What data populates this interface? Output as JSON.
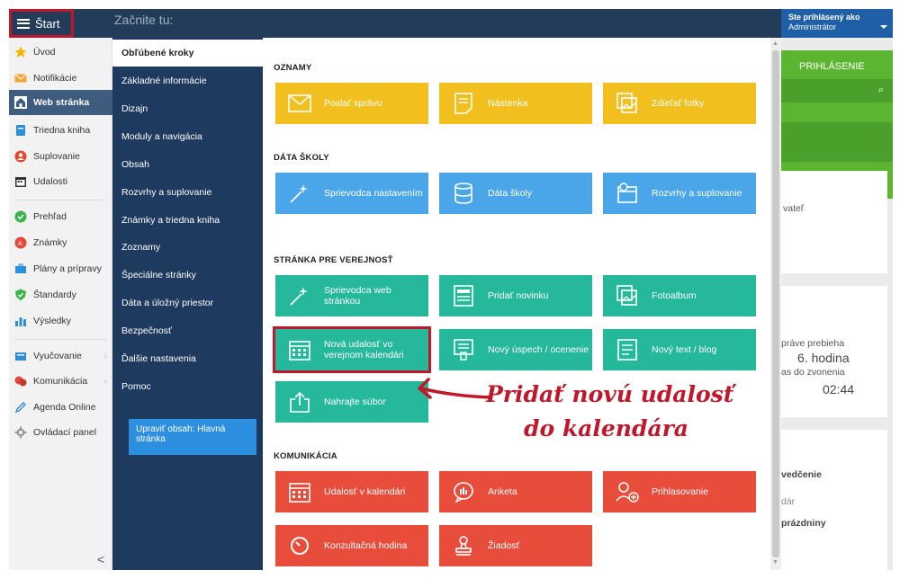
{
  "topbar": {
    "start_label": "Štart",
    "placeholder": "Začnite tu:",
    "login_line1": "Ste prihlásený ako",
    "login_line2": "Administrátor"
  },
  "sidebar": {
    "items": [
      {
        "label": "Úvod",
        "icon": "star-icon"
      },
      {
        "label": "Notifikácie",
        "icon": "envelope-icon"
      },
      {
        "label": "Web stránka",
        "icon": "home-icon",
        "active": true
      },
      {
        "label": "Triedna kniha",
        "icon": "book-icon"
      },
      {
        "label": "Suplovanie",
        "icon": "substitute-icon"
      },
      {
        "label": "Udalosti",
        "icon": "calendar-icon"
      },
      {
        "label": "Prehľad",
        "icon": "check-circle-icon"
      },
      {
        "label": "Známky",
        "icon": "grades-icon"
      },
      {
        "label": "Plány a prípravy",
        "icon": "briefcase-icon"
      },
      {
        "label": "Štandardy",
        "icon": "shield-check-icon"
      },
      {
        "label": "Výsledky",
        "icon": "bar-chart-icon"
      },
      {
        "label": "Vyučovanie",
        "icon": "teaching-icon"
      },
      {
        "label": "Komunikácia",
        "icon": "chat-icon"
      },
      {
        "label": "Agenda Online",
        "icon": "pen-icon"
      },
      {
        "label": "Ovládací panel",
        "icon": "gear-icon"
      }
    ],
    "collapse": "<"
  },
  "menu": {
    "items": [
      "Obľúbené kroky",
      "Základné informácie",
      "Dizajn",
      "Moduly a navigácia",
      "Obsah",
      "Rozvrhy a suplovanie",
      "Známky a triedna kniha",
      "Zoznamy",
      "Špeciálne stránky",
      "Dáta a úložný priestor",
      "Bezpečnosť",
      "Ďalšie nastavenia",
      "Pomoc"
    ],
    "edit_button": "Upraviť obsah: Hlavná stránka"
  },
  "sections": {
    "oznamy": "OZNAMY",
    "data": "DÁTA ŠKOLY",
    "verejnost": "STRÁNKA PRE VEREJNOSŤ",
    "komunikacia": "KOMUNIKÁCIA"
  },
  "tiles": {
    "poslat_spravu": "Poslať správu",
    "nastenka": "Nástenka",
    "zdielat_fotky": "Zdieľať fotky",
    "sprievodca_nastavenim": "Sprievodca nastavením",
    "data_skoly": "Dáta školy",
    "rozvrhy": "Rozvrhy a suplovanie",
    "sprievodca_web": "Sprievodca web stránkou",
    "pridat_novinku": "Pridať novinku",
    "fotoalbum": "Fotoalbum",
    "nova_udalost": "Nová udalosť vo verejnom kalendári",
    "novy_uspech": "Nový úspech / ocenenie",
    "novy_text": "Nový text / blog",
    "nahrajte": "Nahrajte súbor",
    "udalost_kalendar": "Udalosť v kalendári",
    "anketa": "Anketa",
    "prihlasovanie": "Prihlasovanie",
    "konzultacna": "Konzultačná hodina",
    "ziadost": "Žiadosť"
  },
  "callout": {
    "line1": "Pridať novú udalosť",
    "line2": "do kalendára"
  },
  "background": {
    "prihlasenie": "PRIHLÁSENIE",
    "t1": "vateľ",
    "t2": "práve prebieha",
    "t3": "6. hodina",
    "t4": "as do zvonenia",
    "t5": "02:44",
    "t6": "vedčenie",
    "t7": "dár",
    "t8": "prázdniny"
  }
}
